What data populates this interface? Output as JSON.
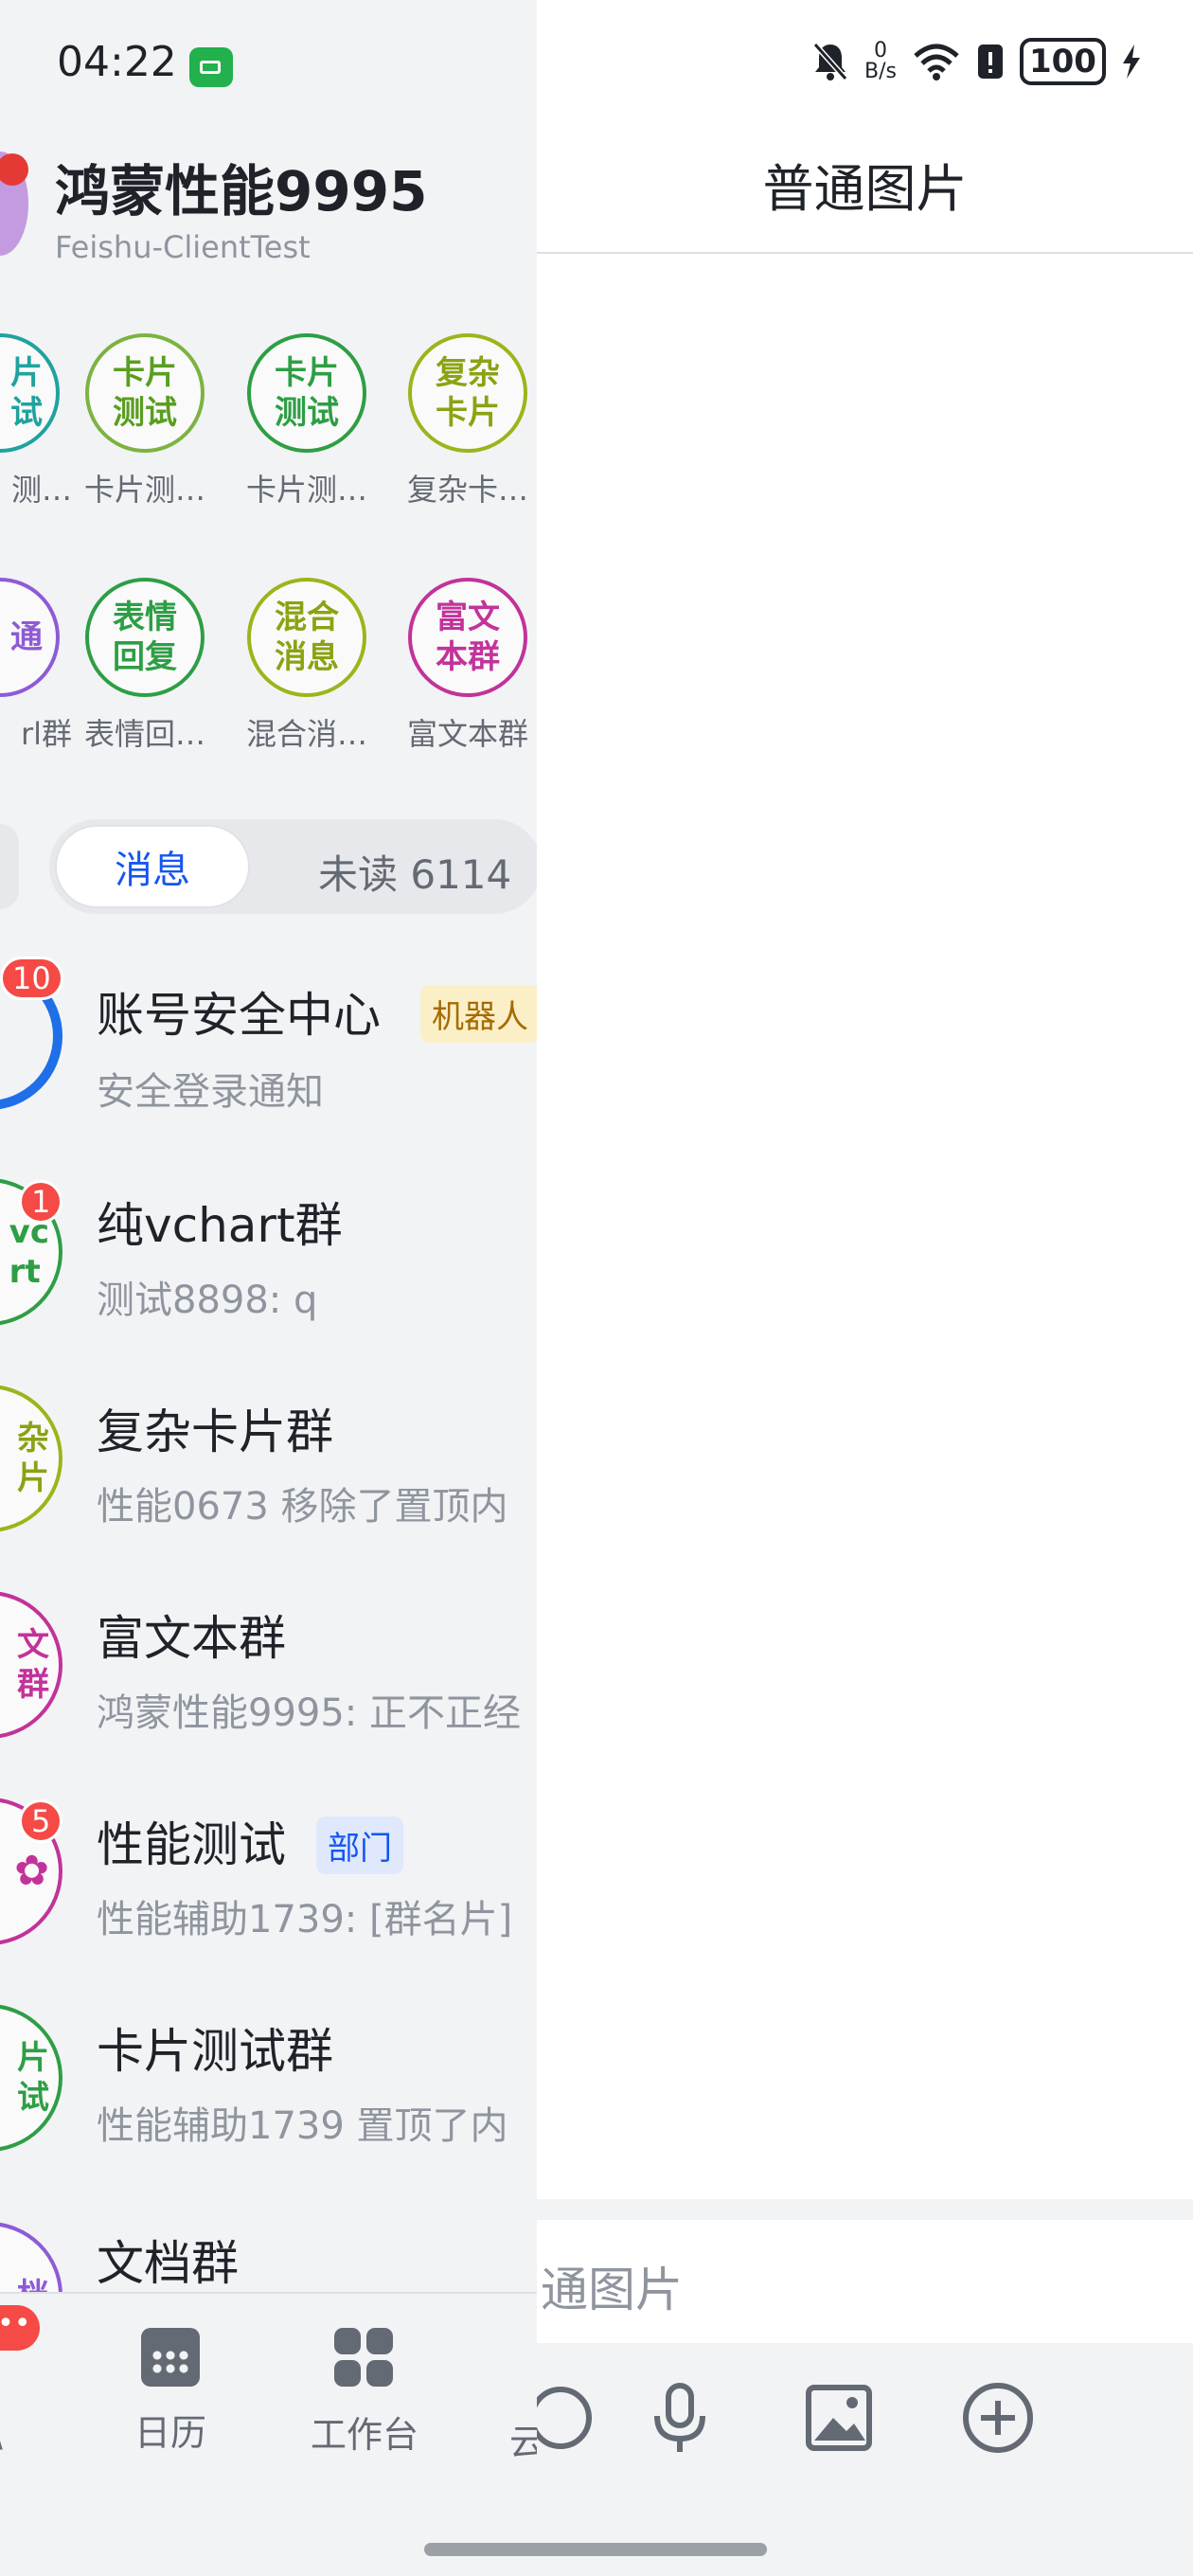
{
  "status_bar": {
    "time": "04:22",
    "net_speed_value": "0",
    "net_speed_unit": "B/s",
    "battery": "100",
    "signal_label": "4"
  },
  "sidebar": {
    "user_name": "鸿蒙性能9995",
    "tenant": "Feishu-ClientTest"
  },
  "shortcuts_row1": [
    {
      "icon_text": "片\n试",
      "label": "测…",
      "color": "#20a39e"
    },
    {
      "icon_text": "卡片\n测试",
      "label": "卡片测…",
      "color": "#7cb342"
    },
    {
      "icon_text": "卡片\n测试",
      "label": "卡片测…",
      "color": "#2e9e45"
    },
    {
      "icon_text": "复杂\n卡片",
      "label": "复杂卡…",
      "color": "#9bb51a"
    }
  ],
  "shortcuts_row2": [
    {
      "icon_text": "通\n",
      "label": "rl群",
      "color": "#8e5bd6"
    },
    {
      "icon_text": "表情\n回复",
      "label": "表情回…",
      "color": "#2e9e45"
    },
    {
      "icon_text": "混合\n消息",
      "label": "混合消…",
      "color": "#9bb51a"
    },
    {
      "icon_text": "富文\n本群",
      "label": "富文本群",
      "color": "#c2339a"
    }
  ],
  "tabs": {
    "active": "消息",
    "other": "未读 6114"
  },
  "chats": [
    {
      "title": "账号安全中心",
      "tag": "机器人",
      "tag_bg": "#fbefc8",
      "tag_color": "#a76b00",
      "preview": "安全登录通知",
      "badge": "10",
      "avatar_text": "",
      "avatar_color": "#1e6fe8"
    },
    {
      "title": "纯vchart群",
      "tag": "",
      "preview": "测试8898: q",
      "badge": "1",
      "avatar_text": "vc\nrt",
      "avatar_color": "#2e9e45"
    },
    {
      "title": "复杂卡片群",
      "tag": "",
      "preview": "性能0673 移除了置顶内",
      "badge": "",
      "avatar_text": "杂\n片",
      "avatar_color": "#9bb51a"
    },
    {
      "title": "富文本群",
      "tag": "",
      "preview": "鸿蒙性能9995: 正不正经",
      "badge": "",
      "avatar_text": "文\n群",
      "avatar_color": "#c2339a"
    },
    {
      "title": "性能测试",
      "tag": "部门",
      "tag_bg": "#dfe8fc",
      "tag_color": "#1456f0",
      "preview": "性能辅助1739: [群名片]",
      "badge": "5",
      "avatar_text": "✿",
      "avatar_color": "#c2339a"
    },
    {
      "title": "卡片测试群",
      "tag": "",
      "preview": "性能辅助1739 置顶了内",
      "badge": "",
      "avatar_text": "片\n试",
      "avatar_color": "#2e9e45"
    },
    {
      "title": "文档群",
      "tag": "",
      "preview": "",
      "badge": "",
      "avatar_text": "档",
      "avatar_color": "#8e5bd6"
    }
  ],
  "bottom_nav": {
    "more_badge": "•••",
    "first_partial": "\\",
    "calendar": "日历",
    "workplace": "工作台",
    "cloud_partial": "云"
  },
  "right_panel": {
    "title": "普通图片",
    "input_text": "通图片"
  }
}
